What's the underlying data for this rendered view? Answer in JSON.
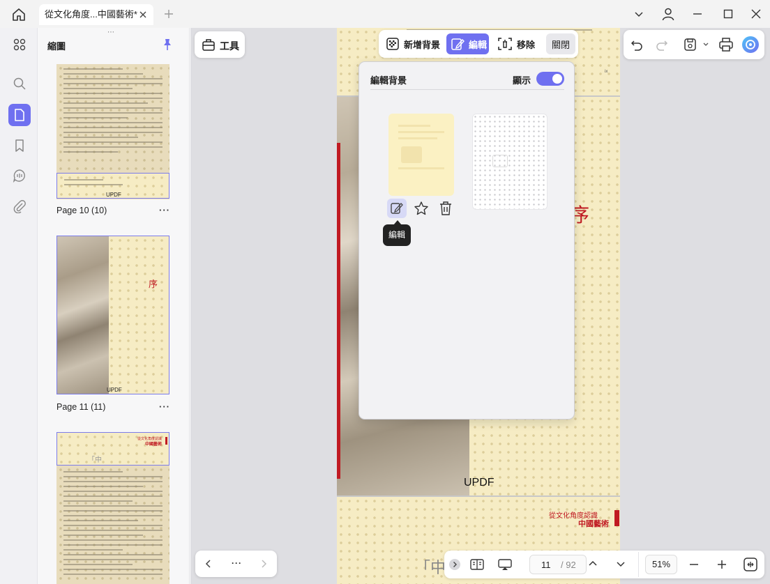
{
  "window": {
    "tab_title": "從文化角度...中國藝術*",
    "colors": {
      "accent": "#6f70f0",
      "thumb_border": "#7b7bea",
      "red": "#c01a22"
    }
  },
  "left_rail": {
    "icons": [
      "apps-icon",
      "search-icon",
      "page-thumbnail-icon",
      "bookmark-icon",
      "comment-icon",
      "attachment-icon"
    ]
  },
  "thumbnails": {
    "title": "縮圖",
    "pages": [
      {
        "label": "Page 10 (10)",
        "watermark": "UPDF"
      },
      {
        "label": "Page 11 (11)",
        "watermark": "UPDF",
        "char": "序"
      },
      {
        "label": "",
        "header_small": "從文化角度認識",
        "header_big": "中國藝術",
        "quote_char": "「中"
      }
    ],
    "more": "···"
  },
  "toolbar": {
    "tools_label": "工具",
    "add_bg_label": "新增背景",
    "edit_label": "編輯",
    "remove_label": "移除",
    "close_label": "關閉"
  },
  "popup": {
    "title": "編輯背景",
    "show_label": "顯示",
    "show_on": true,
    "tooltip": "編輯"
  },
  "page_content": {
    "char": "序",
    "watermark": "UPDF",
    "footer_small": "從文化角度認識",
    "footer_big": "中國藝術",
    "quote_char": "「中",
    "page_num_mark": "ix"
  },
  "bottom": {
    "nav_more": "···",
    "page_current": "11",
    "page_total": "/ 92",
    "zoom": "51%"
  }
}
